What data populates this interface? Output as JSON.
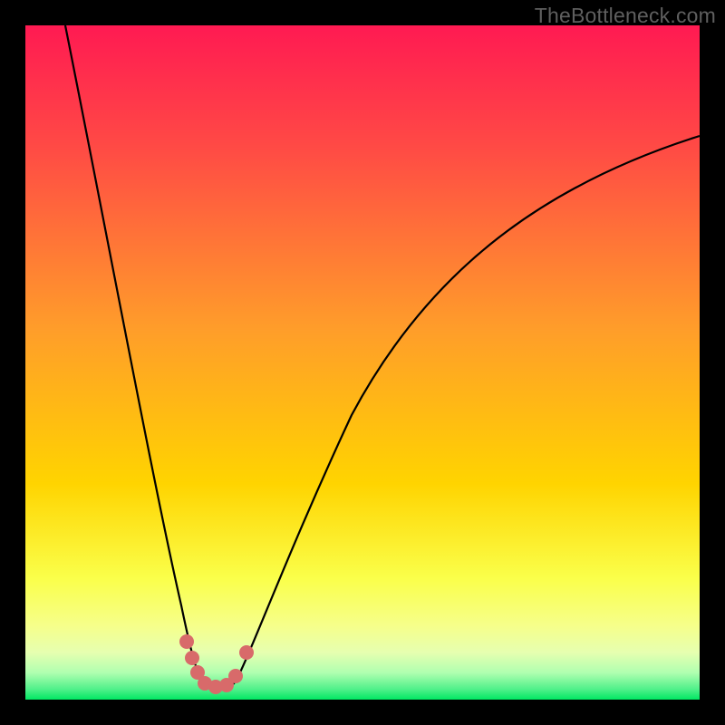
{
  "watermark": "TheBottleneck.com",
  "chart_data": {
    "type": "line",
    "title": "",
    "xlabel": "",
    "ylabel": "",
    "xlim": [
      0,
      100
    ],
    "ylim": [
      0,
      100
    ],
    "gradient_background": {
      "top_color": "#ff1a52",
      "mid_color": "#ffd400",
      "near_bottom_color": "#f6ff8a",
      "bottom_color": "#00e763"
    },
    "curve": {
      "description": "V-shaped bottleneck curve: two branches descending from top-left and top-right to a minimum near x≈26% at the bottom (green zone).",
      "min_x_percent": 26,
      "left_branch_top_x_percent": 6,
      "right_branch_top_x_percent": 100,
      "right_branch_top_y_percent": 83
    },
    "markers": {
      "color": "#d86a6a",
      "count": 8,
      "location": "clustered near curve minimum at bottom"
    }
  }
}
